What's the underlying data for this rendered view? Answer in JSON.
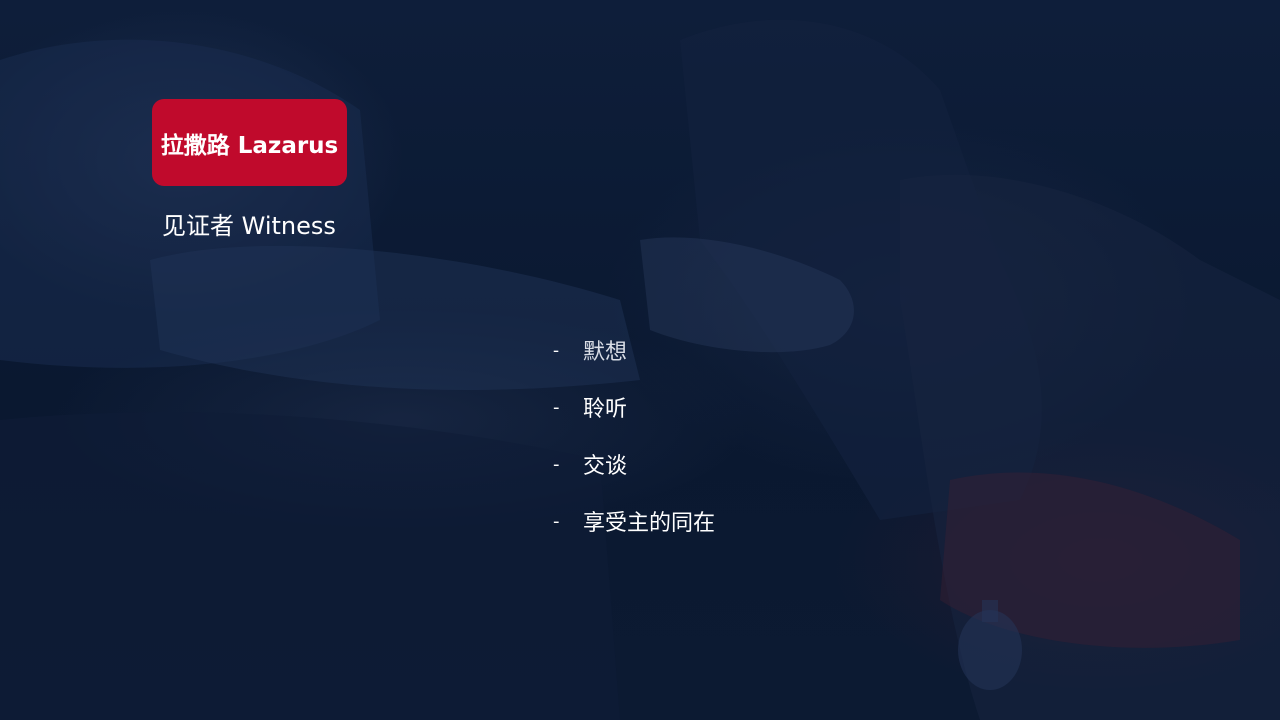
{
  "slide": {
    "title": "拉撒路 Lazarus",
    "title_badge_color": "#c00a2c",
    "subtitle": "见证者 Witness",
    "bullets": [
      {
        "marker": "-",
        "text": "默想"
      },
      {
        "marker": "-",
        "text": "聆听"
      },
      {
        "marker": "-",
        "text": "交谈"
      },
      {
        "marker": "-",
        "text": "享受主的同在"
      }
    ],
    "background_color": "#0b1a33"
  }
}
